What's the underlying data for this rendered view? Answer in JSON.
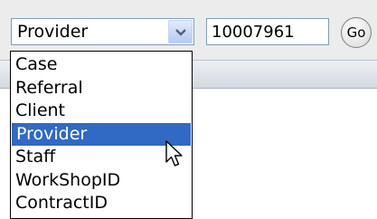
{
  "search": {
    "type_select": {
      "value": "Provider",
      "arrow_icon": "chevron-down-icon"
    },
    "id_input": {
      "value": "10007961"
    },
    "go_button": {
      "label": "Go"
    }
  },
  "dropdown": {
    "options": [
      {
        "label": "Case"
      },
      {
        "label": "Referral"
      },
      {
        "label": "Client"
      },
      {
        "label": "Provider",
        "selected": true
      },
      {
        "label": "Staff"
      },
      {
        "label": "WorkShopID"
      },
      {
        "label": "ContractID"
      }
    ],
    "highlight_color": "#316ac5"
  },
  "cursor": {
    "icon": "mouse-pointer-icon"
  }
}
